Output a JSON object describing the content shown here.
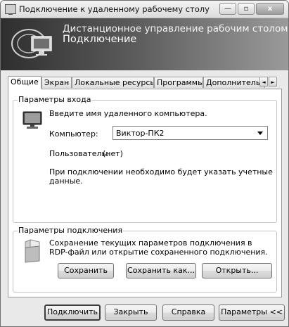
{
  "window": {
    "title": "Подключение к удаленному рабочему столу",
    "controls": {
      "minimize": "—",
      "maximize": "▫",
      "close": "x"
    }
  },
  "banner": {
    "line1": "Дистанционное управление рабочим столом",
    "line2": "Подключение"
  },
  "tabs": [
    {
      "label": "Общие",
      "active": true
    },
    {
      "label": "Экран",
      "active": false
    },
    {
      "label": "Локальные ресурсы",
      "active": false
    },
    {
      "label": "Программы",
      "active": false
    },
    {
      "label": "Дополнительно",
      "active": false
    }
  ],
  "tab_scroll": {
    "left": "◄",
    "right": "►"
  },
  "logon_group": {
    "legend": "Параметры входа",
    "prompt": "Введите имя удаленного компьютера.",
    "computer_label": "Компьютер:",
    "computer_value": "Виктор-ПК2",
    "user_label": "Пользователь:",
    "user_value": "(нет)",
    "note_line1": "При подключении необходимо будет указать учетные",
    "note_line2": "данные."
  },
  "conn_group": {
    "legend": "Параметры подключения",
    "desc_line1": "Сохранение текущих параметров подключения в",
    "desc_line2": "RDP-файл или открытие сохраненного подключения.",
    "save": "Сохранить",
    "save_as": "Сохранить как...",
    "open": "Открыть..."
  },
  "footer": {
    "connect": "Подключить",
    "close": "Закрыть",
    "help": "Справка",
    "options": "Параметры <<"
  }
}
